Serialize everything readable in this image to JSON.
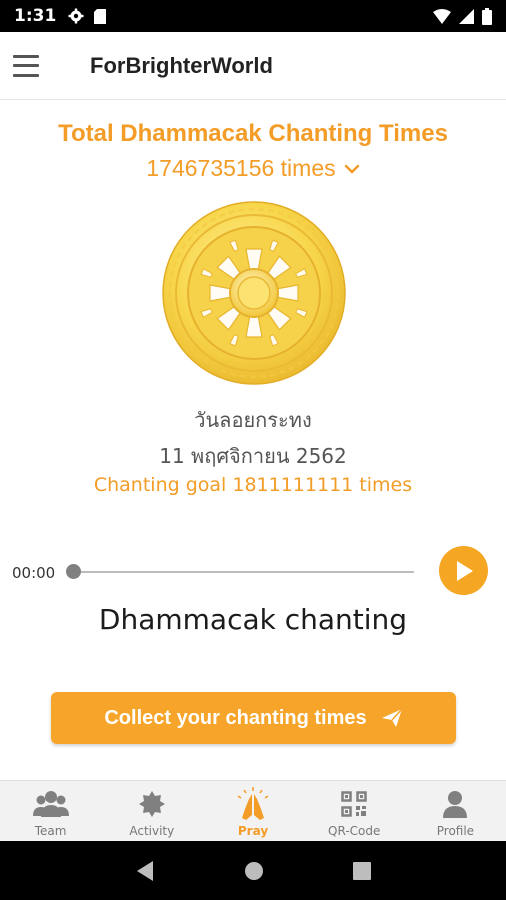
{
  "status_bar": {
    "time": "1:31"
  },
  "app_bar": {
    "title": "ForBrighterWorld"
  },
  "main": {
    "heading": "Total Dhammacak Chanting Times",
    "total_count": "1746735156 times",
    "event_name": "วันลอยกระทง",
    "event_date": "11 พฤศจิกายน 2562",
    "goal": "Chanting goal 1811111111 times"
  },
  "player": {
    "current_time": "00:00",
    "progress": 0,
    "track_title": "Dhammacak chanting"
  },
  "collect_button": {
    "label": "Collect your chanting times"
  },
  "bottom_nav": {
    "items": [
      {
        "label": "Team",
        "icon": "team-icon"
      },
      {
        "label": "Activity",
        "icon": "activity-icon"
      },
      {
        "label": "Pray",
        "icon": "pray-icon",
        "active": true
      },
      {
        "label": "QR-Code",
        "icon": "qr-code-icon"
      },
      {
        "label": "Profile",
        "icon": "profile-icon"
      }
    ]
  },
  "colors": {
    "accent": "#f39c27",
    "button": "#f7a52a",
    "wheel_gold": "#f8d64a"
  }
}
